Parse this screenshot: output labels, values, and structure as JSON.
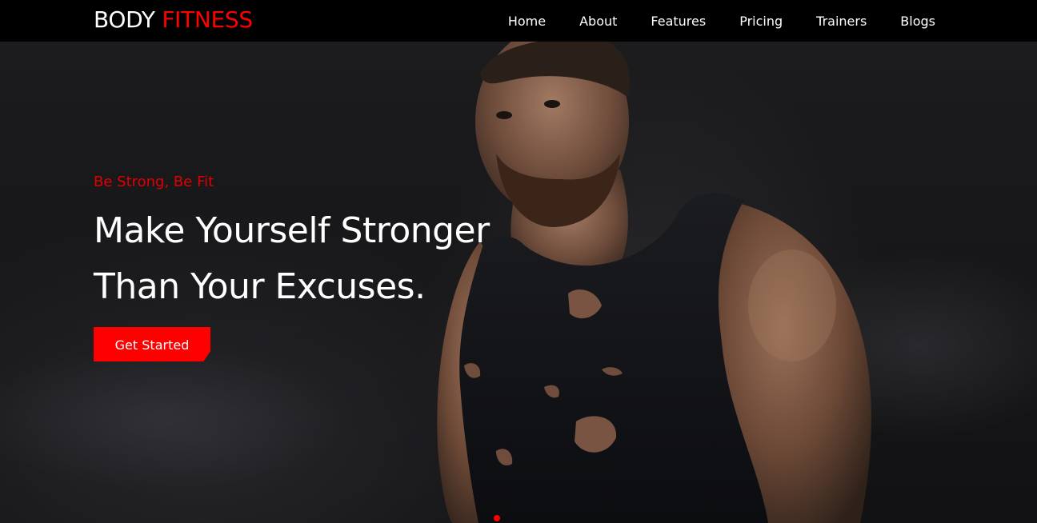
{
  "brand": {
    "part1": "BODY",
    "part2": "FITNESS",
    "accent_color": "#ff0000"
  },
  "nav": {
    "items": [
      {
        "label": "Home"
      },
      {
        "label": "About"
      },
      {
        "label": "Features"
      },
      {
        "label": "Pricing"
      },
      {
        "label": "Trainers"
      },
      {
        "label": "Blogs"
      }
    ]
  },
  "hero": {
    "tagline": "Be Strong, Be Fit",
    "headline_line1": "Make Yourself Stronger",
    "headline_line2": "Than Your Excuses.",
    "cta_label": "Get Started",
    "background_image": "man-in-black-tank-top-image",
    "carousel_active_color": "#ff0000"
  }
}
